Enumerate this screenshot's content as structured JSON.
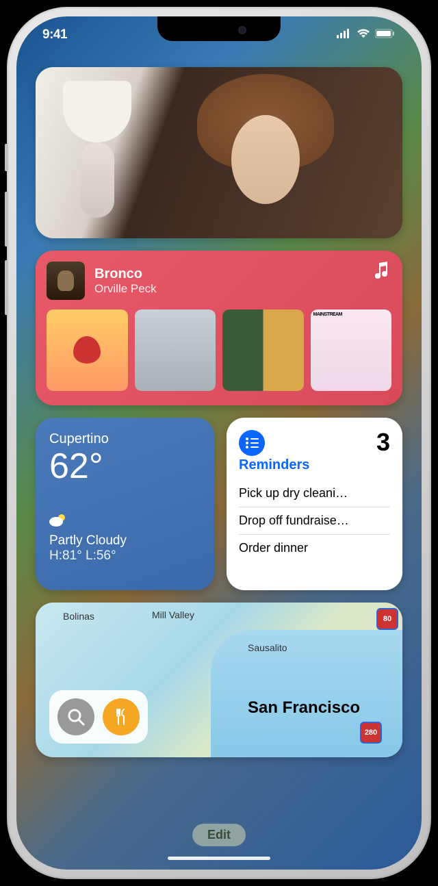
{
  "status": {
    "time": "9:41"
  },
  "music": {
    "title": "Bronco",
    "artist": "Orville Peck"
  },
  "weather": {
    "city": "Cupertino",
    "temp": "62°",
    "condition": "Partly Cloudy",
    "hilo": "H:81° L:56°"
  },
  "reminders": {
    "count": "3",
    "title": "Reminders",
    "items": [
      "Pick up dry cleani…",
      "Drop off fundraise…",
      "Order dinner"
    ]
  },
  "map": {
    "labels": {
      "bolinas": "Bolinas",
      "millvalley": "Mill Valley",
      "sausalito": "Sausalito",
      "sf": "San Francisco"
    },
    "shields": {
      "i80": "80",
      "i280": "280"
    }
  },
  "edit": "Edit"
}
